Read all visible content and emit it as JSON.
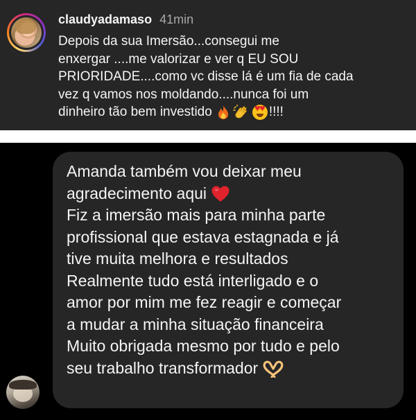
{
  "comment": {
    "username": "claudyadamaso",
    "time": "41min",
    "lines": [
      "Depois da sua Imersão...consegui me",
      "enxergar ....me valorizar e ver q EU SOU",
      "PRIORIDADE....como vc disse lá é um fia  de cada",
      "vez q vamos nos moldando....nunca foi um",
      "dinheiro tão bem investido"
    ],
    "emojis": [
      "fire-emoji",
      "clapping-hands-emoji",
      "heart-eyes-emoji"
    ],
    "trailing": "!!!!"
  },
  "message": {
    "lines": [
      "Amanda também vou deixar meu",
      "agradecimento aqui",
      "Fiz a imersão mais para minha parte",
      "profissional que estava estagnada e já",
      "tive muita melhora e resultados",
      "Realmente tudo está interligado e o",
      "amor por mim me fez reagir e começar",
      "a mudar a minha situação financeira",
      "Muito obrigada mesmo por tudo e pelo",
      "seu trabalho transformador"
    ],
    "emojis": [
      "red-heart-emoji",
      "heart-hands-emoji"
    ]
  },
  "colors": {
    "comment_bg": "#262626",
    "message_bg": "#000000",
    "bubble_bg": "#262626",
    "text": "#f5f5f5",
    "timestamp": "#a8a8a8"
  }
}
